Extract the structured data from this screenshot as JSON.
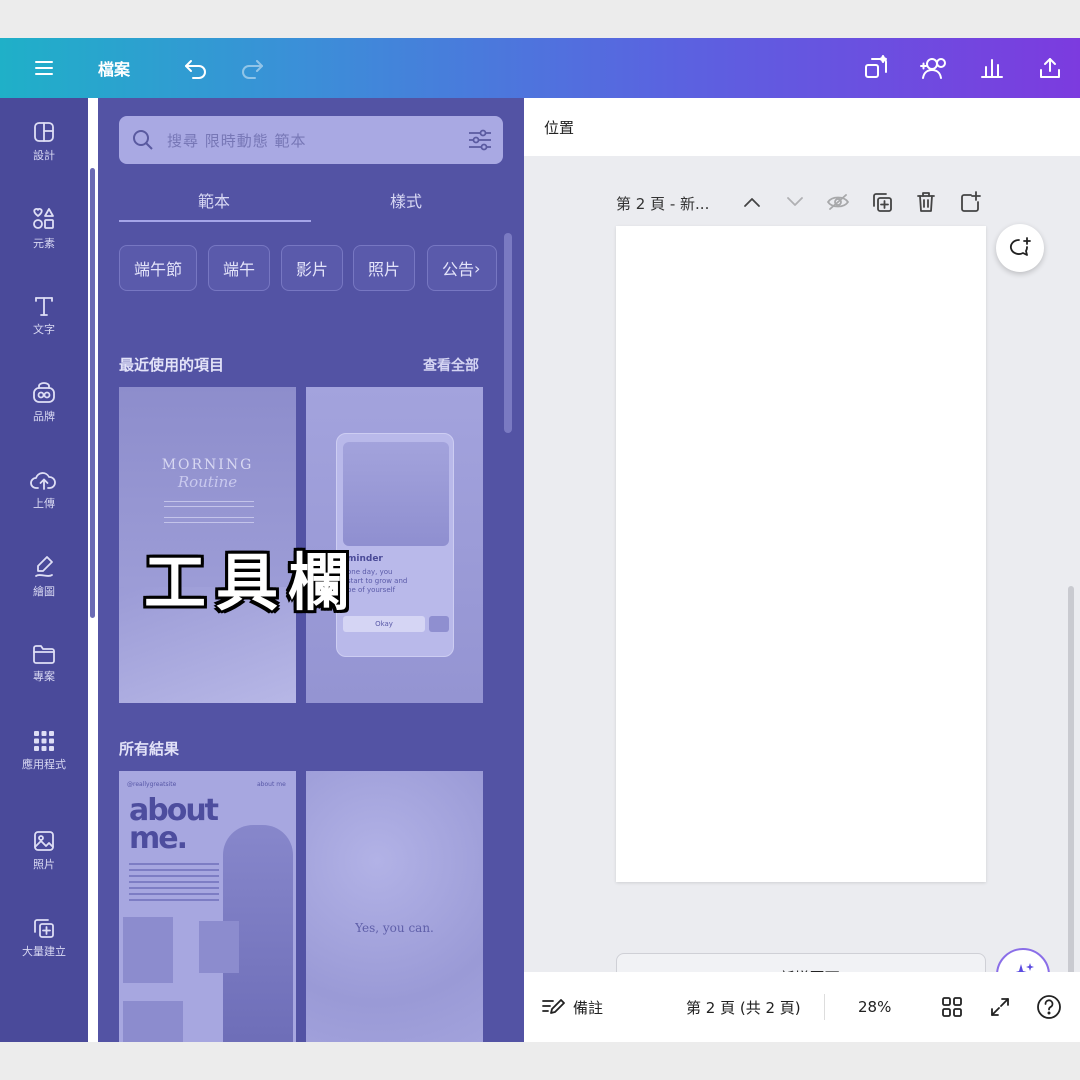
{
  "topbar": {
    "menu_icon": "hamburger-icon",
    "file_label": "檔案",
    "undo_icon": "undo-icon",
    "redo_icon": "redo-icon",
    "right_icons": [
      "magic-resize-icon",
      "share-people-icon",
      "analytics-icon",
      "upload-icon"
    ],
    "gradient": [
      "#1fb0c8",
      "#7c3bdf"
    ]
  },
  "rail": {
    "items": [
      {
        "label": "設計",
        "icon": "layout-icon"
      },
      {
        "label": "元素",
        "icon": "shapes-icon"
      },
      {
        "label": "文字",
        "icon": "text-icon"
      },
      {
        "label": "品牌",
        "icon": "brand-icon"
      },
      {
        "label": "上傳",
        "icon": "cloud-upload-icon"
      },
      {
        "label": "繪圖",
        "icon": "draw-icon"
      },
      {
        "label": "專案",
        "icon": "folder-icon"
      },
      {
        "label": "應用程式",
        "icon": "apps-grid-icon"
      },
      {
        "label": "照片",
        "icon": "photo-icon"
      },
      {
        "label": "大量建立",
        "icon": "bulk-create-icon"
      }
    ]
  },
  "panel": {
    "search_placeholder": "搜尋 限時動態 範本",
    "tabs": [
      "範本",
      "樣式"
    ],
    "chips": [
      "端午節",
      "端午",
      "影片",
      "照片",
      "公告"
    ],
    "recent_title": "最近使用的項目",
    "see_all": "查看全部",
    "all_results_title": "所有結果",
    "thumb1": {
      "line1": "MORNING",
      "line2": "Routine"
    },
    "thumb2": {
      "title": "minder",
      "body": "one day, you\nstart to grow and\nbe of yourself",
      "button": "Okay"
    },
    "thumb3": {
      "handle": "@reallygreatsite",
      "side": "about me",
      "title1": "about",
      "title2": "me."
    },
    "thumb4": {
      "quote": "Yes, you can."
    },
    "overlay_text": "工具欄"
  },
  "canvas": {
    "position_label": "位置",
    "page_header": "第 2 頁 - 新...",
    "add_page": "+ 新增頁面"
  },
  "bottombar": {
    "notes": "備註",
    "page_indicator": "第 2 頁 (共 2 頁)",
    "zoom": "28%"
  }
}
